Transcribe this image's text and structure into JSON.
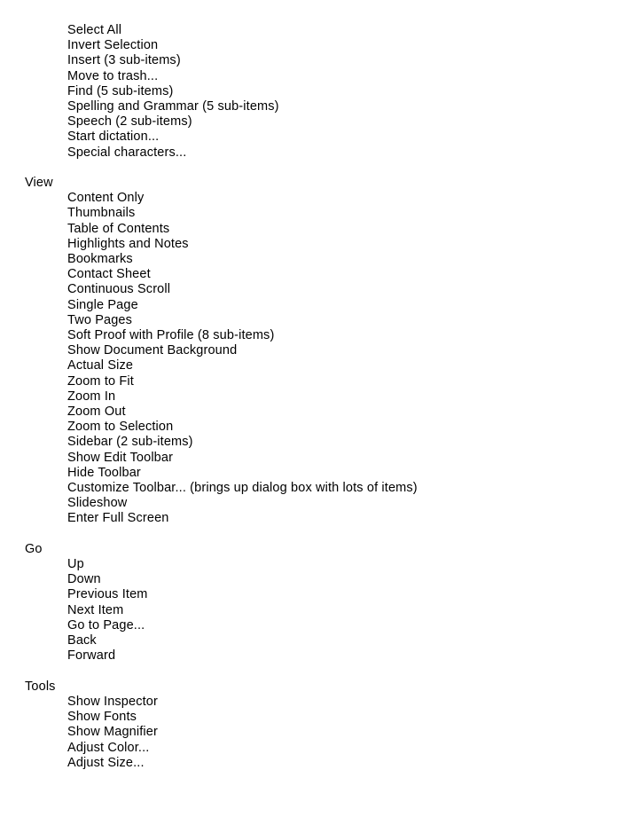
{
  "document": {
    "type": "menu-outline",
    "text_color": "#000000",
    "background_color": "#ffffff",
    "sections": [
      {
        "header": "",
        "header_visible": false,
        "items": [
          "Select All",
          "Invert Selection",
          "Insert (3 sub-items)",
          "Move to trash...",
          "Find (5 sub-items)",
          "Spelling and Grammar (5 sub-items)",
          "Speech (2 sub-items)",
          "Start dictation...",
          "Special characters..."
        ]
      },
      {
        "header": "View",
        "header_visible": true,
        "items": [
          "Content Only",
          "Thumbnails",
          "Table of Contents",
          "Highlights and Notes",
          "Bookmarks",
          "Contact Sheet",
          "Continuous Scroll",
          "Single Page",
          "Two Pages",
          "Soft Proof with Profile (8 sub-items)",
          "Show Document Background",
          "Actual Size",
          "Zoom to Fit",
          "Zoom In",
          "Zoom Out",
          "Zoom to Selection",
          "Sidebar (2 sub-items)",
          "Show Edit Toolbar",
          "Hide Toolbar",
          "Customize Toolbar... (brings up dialog box with lots of items)",
          "Slideshow",
          "Enter Full Screen"
        ]
      },
      {
        "header": "Go",
        "header_visible": true,
        "items": [
          "Up",
          "Down",
          "Previous Item",
          "Next Item",
          "Go to Page...",
          "Back",
          "Forward"
        ]
      },
      {
        "header": "Tools",
        "header_visible": true,
        "items": [
          "Show Inspector",
          "Show Fonts",
          "Show Magnifier",
          "Adjust Color...",
          "Adjust Size..."
        ]
      }
    ]
  }
}
